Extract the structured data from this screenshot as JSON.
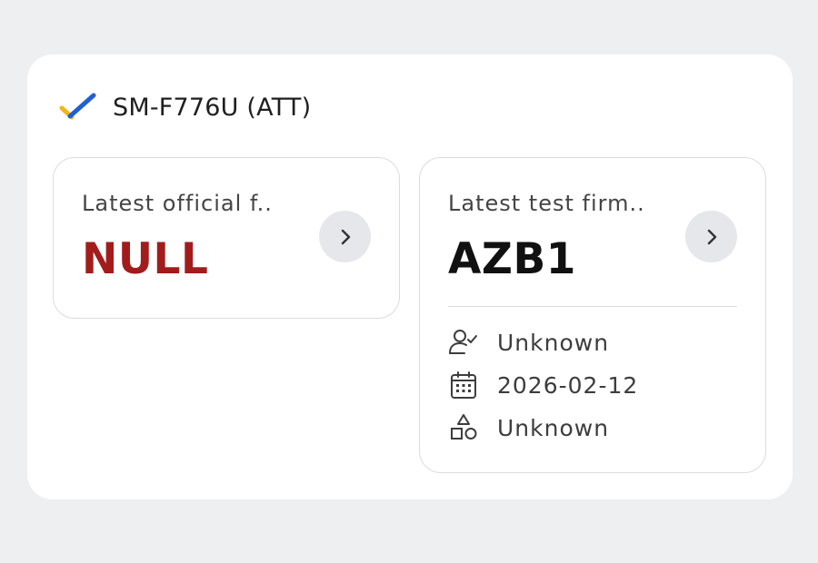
{
  "device": {
    "title": "SM-F776U (ATT)",
    "status_icon": "check-icon"
  },
  "official_firmware": {
    "label": "Latest official f..",
    "value": "NULL",
    "value_color": "#a31c1c"
  },
  "test_firmware": {
    "label": "Latest test firm..",
    "value": "AZB1",
    "details": [
      {
        "icon": "user-check-icon",
        "text": "Unknown"
      },
      {
        "icon": "calendar-icon",
        "text": "2026-02-12"
      },
      {
        "icon": "shapes-icon",
        "text": "Unknown"
      }
    ]
  },
  "colors": {
    "background": "#eeeff1",
    "card": "#ffffff",
    "check_blue": "#1f5fd4",
    "check_yellow": "#f2b51c",
    "null_red": "#a31c1c",
    "chevron_button": "#e6e7eb"
  }
}
